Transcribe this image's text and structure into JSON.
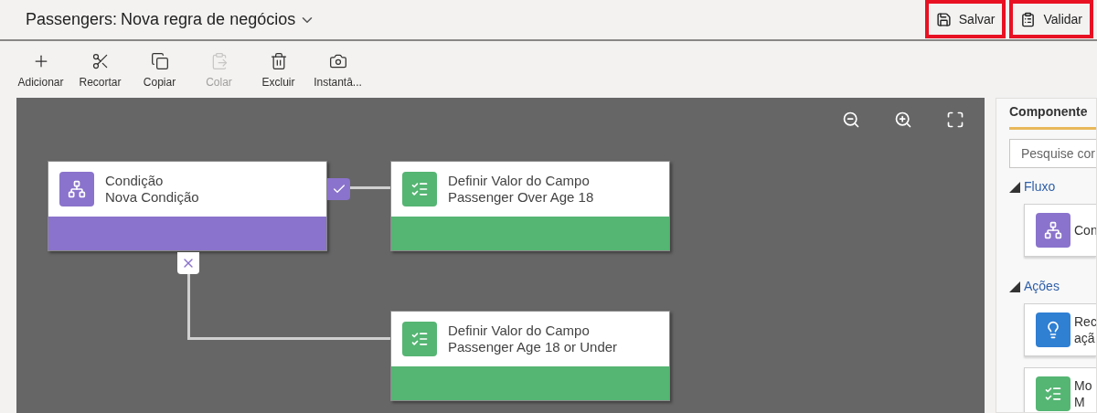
{
  "header": {
    "entity": "Passengers:",
    "title": "Nova regra de negócios",
    "actions": [
      {
        "kind": "save",
        "label": "Salvar",
        "highlighted": true
      },
      {
        "kind": "validate",
        "label": "Validar",
        "highlighted": true
      }
    ]
  },
  "toolbar": [
    {
      "kind": "add",
      "label": "Adicionar",
      "disabled": false
    },
    {
      "kind": "cut",
      "label": "Recortar",
      "disabled": false
    },
    {
      "kind": "copy",
      "label": "Copiar",
      "disabled": false
    },
    {
      "kind": "paste",
      "label": "Colar",
      "disabled": true
    },
    {
      "kind": "delete",
      "label": "Excluir",
      "disabled": false
    },
    {
      "kind": "snapshot",
      "label": "Instantâ..."
    }
  ],
  "canvas": {
    "nodes": [
      {
        "kind": "condition",
        "type": "Condição",
        "name": "Nova Condição"
      },
      {
        "kind": "action",
        "type": "Definir Valor do Campo",
        "name": "Passenger Over Age 18"
      },
      {
        "kind": "action",
        "type": "Definir Valor do Campo",
        "name": "Passenger Age 18 or Under"
      }
    ]
  },
  "panel": {
    "tab": "Componente",
    "search": {
      "placeholder": "Pesquise cor"
    },
    "sections": [
      {
        "title": "Fluxo",
        "expanded": true,
        "items": [
          {
            "kind": "condition",
            "lines": [
              "Con"
            ]
          }
        ]
      },
      {
        "title": "Ações",
        "expanded": true,
        "items": [
          {
            "kind": "recommend",
            "lines": [
              "Rec",
              "açã"
            ]
          },
          {
            "kind": "action",
            "lines": [
              "Mo",
              "M"
            ]
          }
        ]
      }
    ]
  }
}
